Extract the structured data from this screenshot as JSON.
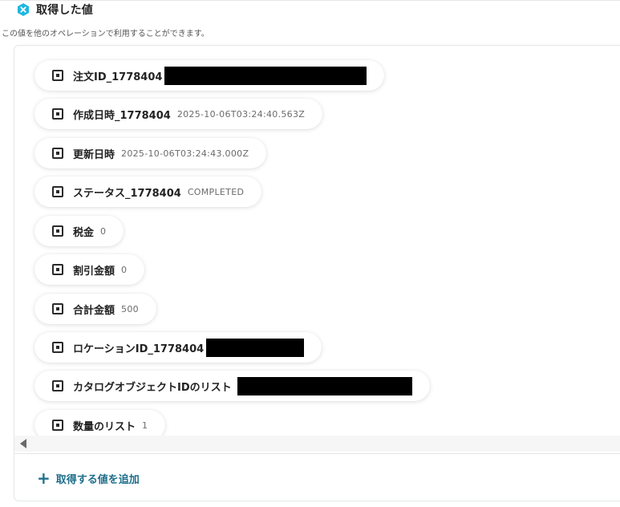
{
  "section": {
    "title": "取得した値",
    "description": "この値を他のオペレーションで利用することができます。",
    "badge_icon": "x-hexagon-icon",
    "badge_color": "#1eb7e0"
  },
  "fields": [
    {
      "label": "注文ID_1778404",
      "value": "",
      "redacted": true
    },
    {
      "label": "作成日時_1778404",
      "value": "2025-10-06T03:24:40.563Z",
      "redacted": false
    },
    {
      "label": "更新日時",
      "value": "2025-10-06T03:24:43.000Z",
      "redacted": false
    },
    {
      "label": "ステータス_1778404",
      "value": "COMPLETED",
      "redacted": false
    },
    {
      "label": "税金",
      "value": "0",
      "redacted": false
    },
    {
      "label": "割引金額",
      "value": "0",
      "redacted": false
    },
    {
      "label": "合計金額",
      "value": "500",
      "redacted": false
    },
    {
      "label": "ロケーションID_1778404",
      "value": "",
      "redacted": true
    },
    {
      "label": "カタログオブジェクトIDのリスト",
      "value": "",
      "redacted": true
    },
    {
      "label": "数量のリスト",
      "value": "1",
      "redacted": false
    }
  ],
  "field_icon": "variable-square-icon",
  "add_button": {
    "icon": "plus-icon",
    "label": "取得する値を追加"
  },
  "colors": {
    "accent": "#1f6f8b",
    "redaction": "#000000"
  }
}
